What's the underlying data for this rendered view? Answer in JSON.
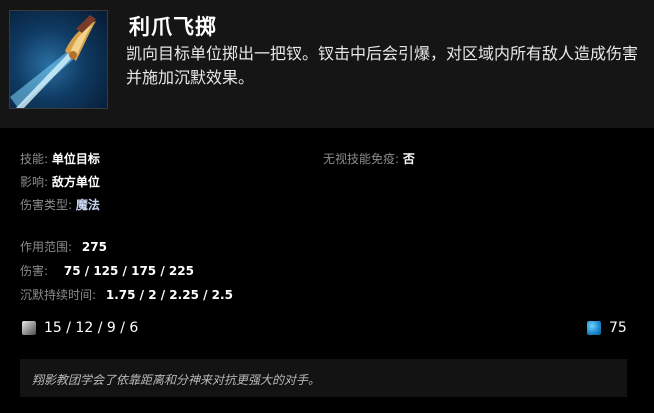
{
  "ability": {
    "name": "利爪飞掷",
    "description": "凯向目标单位掷出一把钗。钗击中后会引爆，对区域内所有敌人造成伤害并施加沉默效果。"
  },
  "stats": {
    "ability_label": "技能:",
    "ability_value": "单位目标",
    "affects_label": "影响:",
    "affects_value": "敌方单位",
    "damage_type_label": "伤害类型:",
    "damage_type_value": "魔法",
    "pierce_label": "无视技能免疫:",
    "pierce_value": "否",
    "radius_label": "作用范围:",
    "radius_value": "275",
    "damage_label": "伤害:",
    "damage_value": "75 / 125 / 175 / 225",
    "silence_label": "沉默持续时间:",
    "silence_value": "1.75 / 2 / 2.25 / 2.5"
  },
  "cooldown": {
    "value": "15 / 12 / 9 / 6",
    "icon": "cooldown-icon"
  },
  "mana": {
    "value": "75",
    "icon": "mana-icon",
    "color": "#1b86c9"
  },
  "lore": "翔影教团学会了依靠距离和分神来对抗更强大的对手。"
}
